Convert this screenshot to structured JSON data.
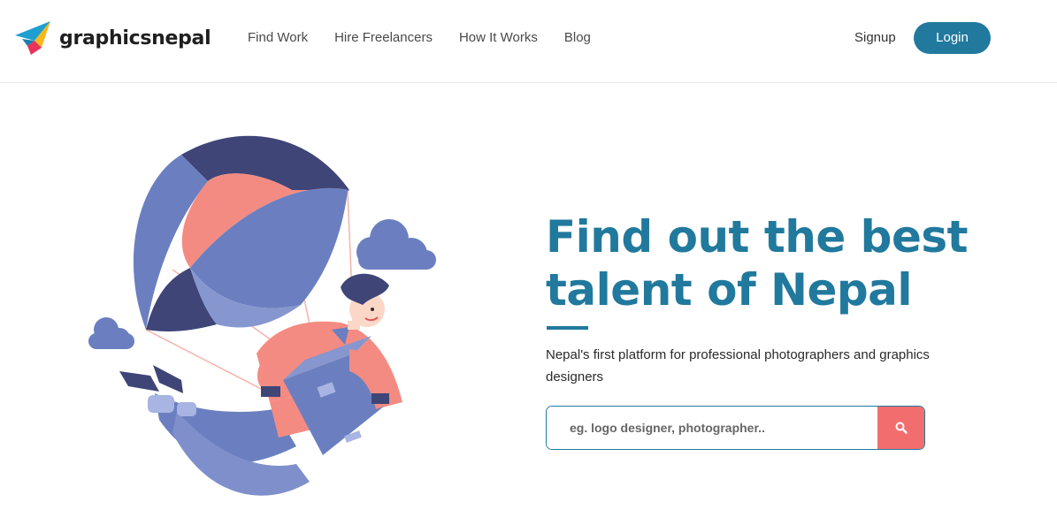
{
  "brand": {
    "name": "graphicsnepal",
    "icon": "paper-plane-logo"
  },
  "nav": {
    "links": [
      "Find Work",
      "Hire Freelancers",
      "How It Works",
      "Blog"
    ],
    "signup_label": "Signup",
    "login_label": "Login"
  },
  "hero": {
    "title_line1": "Find out the best",
    "title_line2": "talent of Nepal",
    "subtitle": "Nepal's first platform for professional photographers and graphics designers",
    "search_placeholder": "eg. logo designer, photographer..",
    "search_icon": "search-icon"
  },
  "colors": {
    "primary": "#21799d",
    "accent": "#f26e6e",
    "illustration_blue": "#6b7fc0",
    "illustration_navy": "#3f4577",
    "illustration_salmon": "#f48b82"
  }
}
